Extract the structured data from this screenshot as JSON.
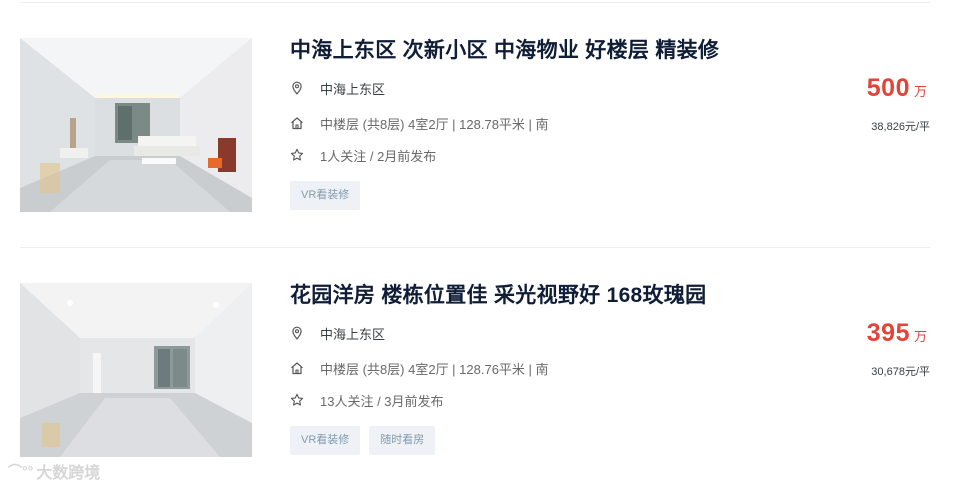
{
  "listings": [
    {
      "title": "中海上东区 次新小区 中海物业 好楼层 精装修",
      "community": "中海上东区",
      "house_info": "中楼层 (共8层) 4室2厅 | 128.78平米 | 南",
      "follow_info": "1人关注 / 2月前发布",
      "tags": [
        "VR看装修"
      ],
      "total_price": "500",
      "price_unit": "万",
      "unit_price": "38,826元/平"
    },
    {
      "title": "花园洋房 楼栋位置佳 采光视野好 168玫瑰园",
      "community": "中海上东区",
      "house_info": "中楼层 (共8层) 4室2厅 | 128.76平米 | 南",
      "follow_info": "13人关注 / 3月前发布",
      "tags": [
        "VR看装修",
        "随时看房"
      ],
      "total_price": "395",
      "price_unit": "万",
      "unit_price": "30,678元/平"
    }
  ],
  "icons": {
    "location": "location-pin-icon",
    "house": "house-icon",
    "follow": "star-icon"
  },
  "colors": {
    "title": "#101d37",
    "price": "#e1453a",
    "tag_bg": "#eef2f7",
    "tag_text": "#849aae"
  },
  "watermark": {
    "logo": "大数跨境",
    "symbol": "⌒°°"
  }
}
